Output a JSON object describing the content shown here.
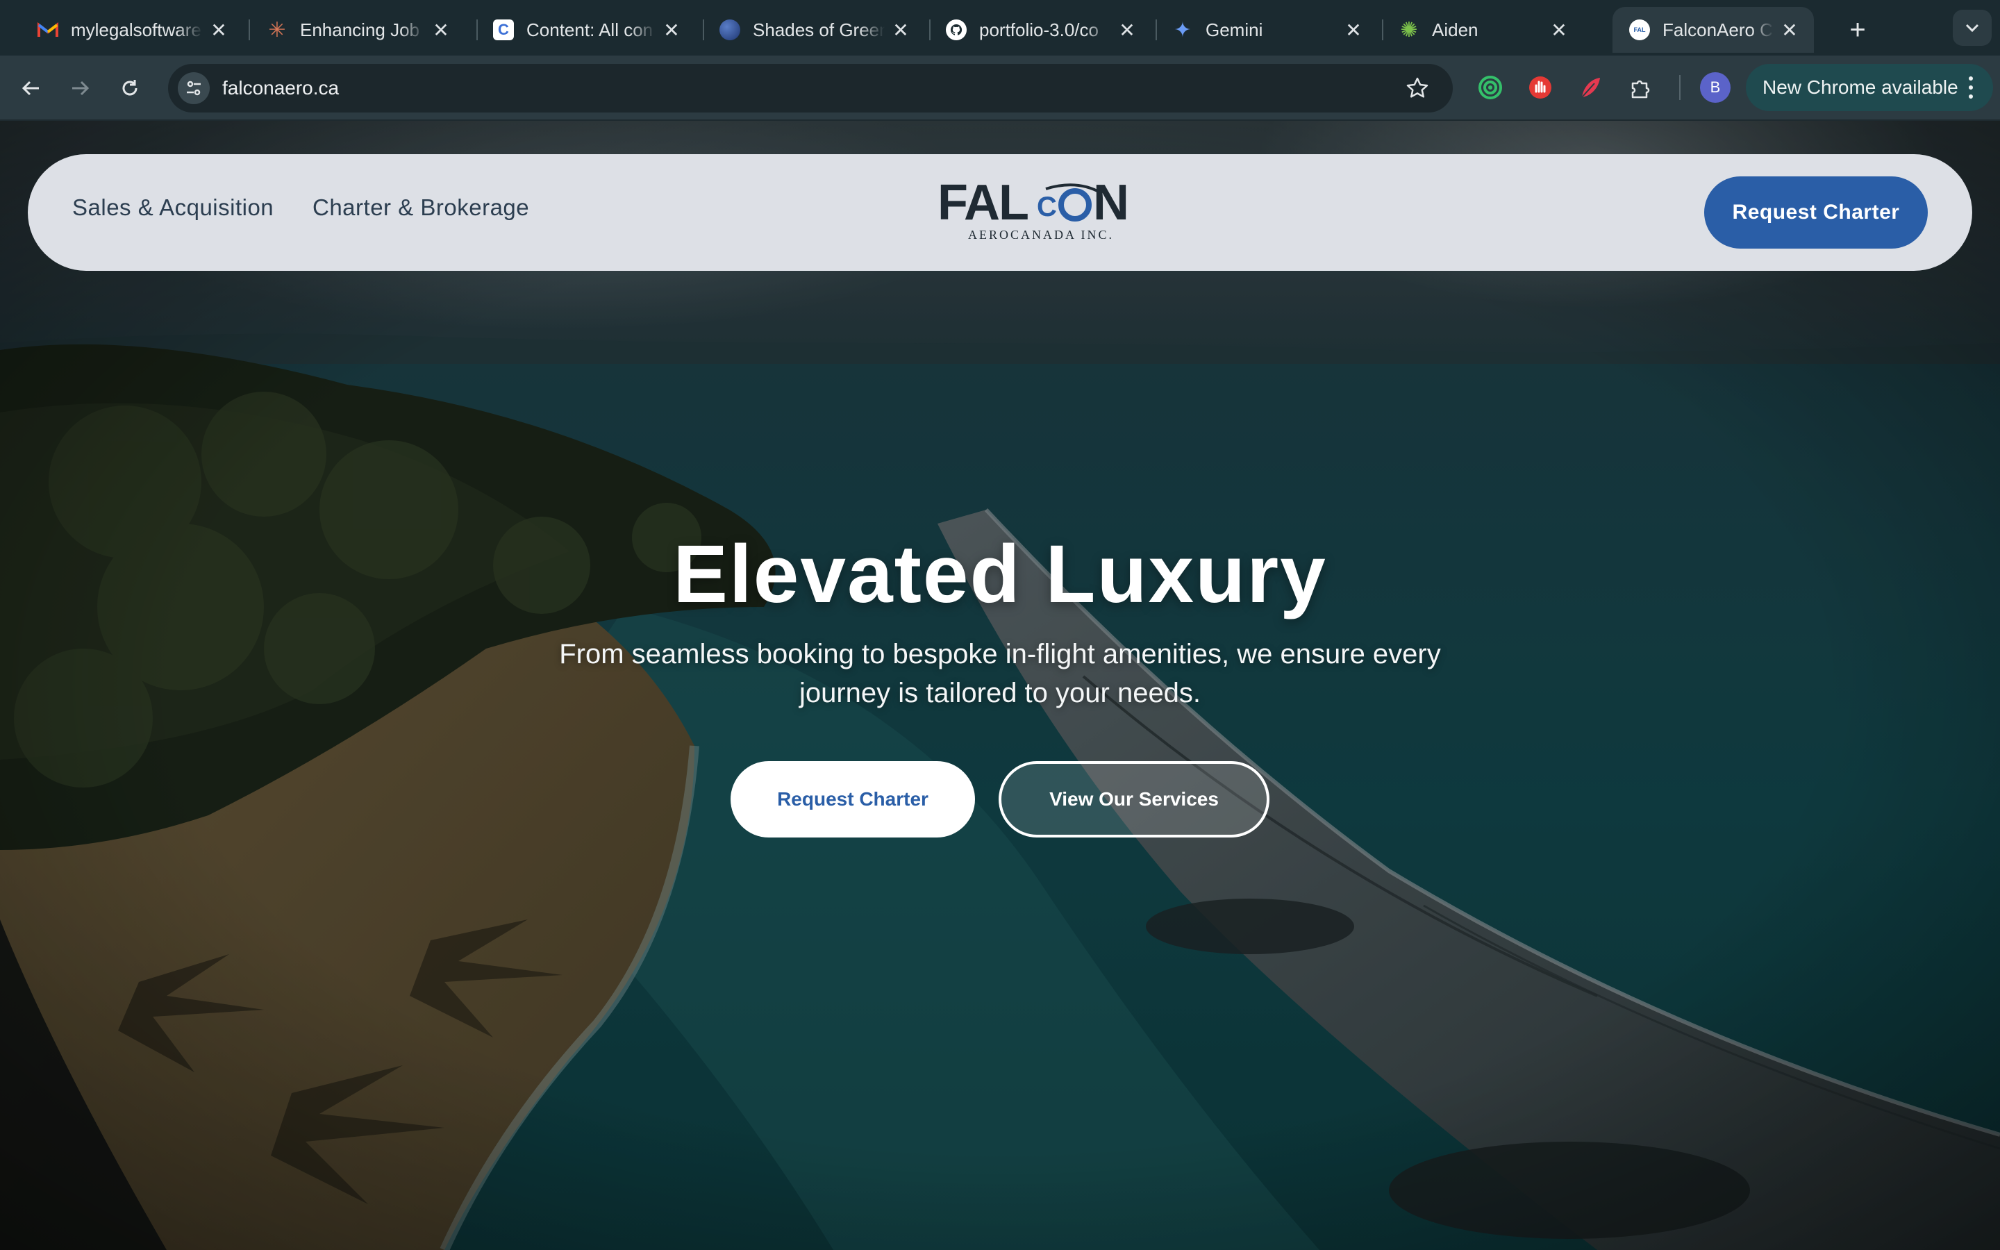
{
  "browser": {
    "tabs": [
      {
        "title": "mylegalsoftware",
        "icon": "gmail-icon"
      },
      {
        "title": "Enhancing Job S",
        "icon": "claude-icon"
      },
      {
        "title": "Content: All con",
        "icon": "content-app-icon"
      },
      {
        "title": "Shades of Green",
        "icon": "globe-icon"
      },
      {
        "title": "portfolio-3.0/co",
        "icon": "github-icon"
      },
      {
        "title": "Gemini",
        "icon": "gemini-icon"
      },
      {
        "title": "Aiden",
        "icon": "aiden-icon"
      },
      {
        "title": "FalconAero Cana",
        "icon": "falcon-favicon-icon",
        "active": true
      }
    ],
    "url": "falconaero.ca",
    "update_label": "New Chrome available",
    "profile_initial": "B",
    "accent_color": "#1f4a4f"
  },
  "site": {
    "nav": {
      "links": [
        "Sales & Acquisition",
        "Charter & Brokerage"
      ],
      "cta": "Request Charter"
    },
    "logo": {
      "wordmark_left": "FAL",
      "wordmark_right": "N",
      "tagline": "AEROCANADA  INC."
    },
    "hero": {
      "title": "Elevated Luxury",
      "subtitle": "From seamless booking to bespoke in-flight amenities, we ensure every journey is tailored to your needs.",
      "primary_cta": "Request Charter",
      "secondary_cta": "View Our Services"
    },
    "brand_color": "#2a5ea7"
  }
}
